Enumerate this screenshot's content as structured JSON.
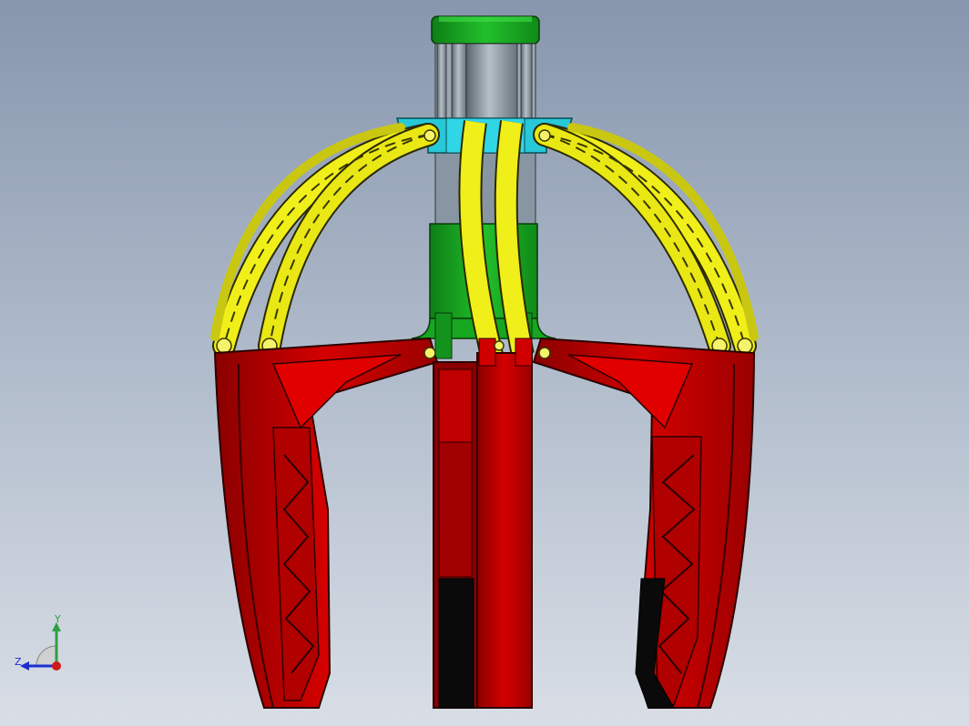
{
  "viewport": {
    "background_top": "#8796ad",
    "background_bottom": "#d9dee6"
  },
  "model": {
    "parts": [
      {
        "name": "cylinder-cap",
        "color": "#15a51f"
      },
      {
        "name": "piston-rods",
        "color": "#8c9aa6"
      },
      {
        "name": "cylinder-body",
        "color": "#15a51f"
      },
      {
        "name": "yoke",
        "color": "#27c8d8"
      },
      {
        "name": "linkage-arms",
        "color": "#f0ef1a"
      },
      {
        "name": "claw-fingers",
        "color": "#d00000"
      },
      {
        "name": "finger-pads",
        "color": "#0a0a0a"
      }
    ]
  },
  "triad": {
    "y_label": "Y",
    "z_label": "Z",
    "y_color": "#2ea043",
    "z_color": "#1b2fd1",
    "x_color": "#d11a1a"
  }
}
